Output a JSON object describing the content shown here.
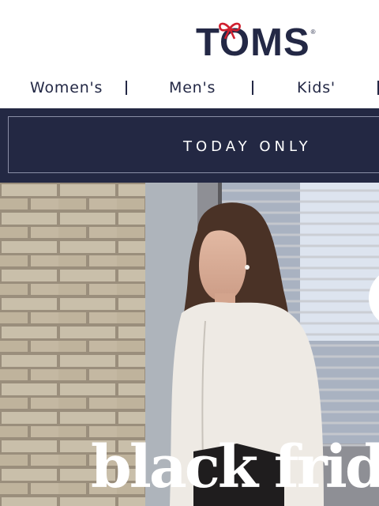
{
  "brand": {
    "name": "TOMS",
    "registered_mark": "®"
  },
  "nav": {
    "items": [
      {
        "label": "Women's"
      },
      {
        "label": "Men's"
      },
      {
        "label": "Kids'"
      }
    ]
  },
  "promo": {
    "text": "TODAY ONLY"
  },
  "hero": {
    "headline": "black frida"
  },
  "colors": {
    "navy": "#232843",
    "bow_red": "#d0202f",
    "white": "#ffffff"
  }
}
